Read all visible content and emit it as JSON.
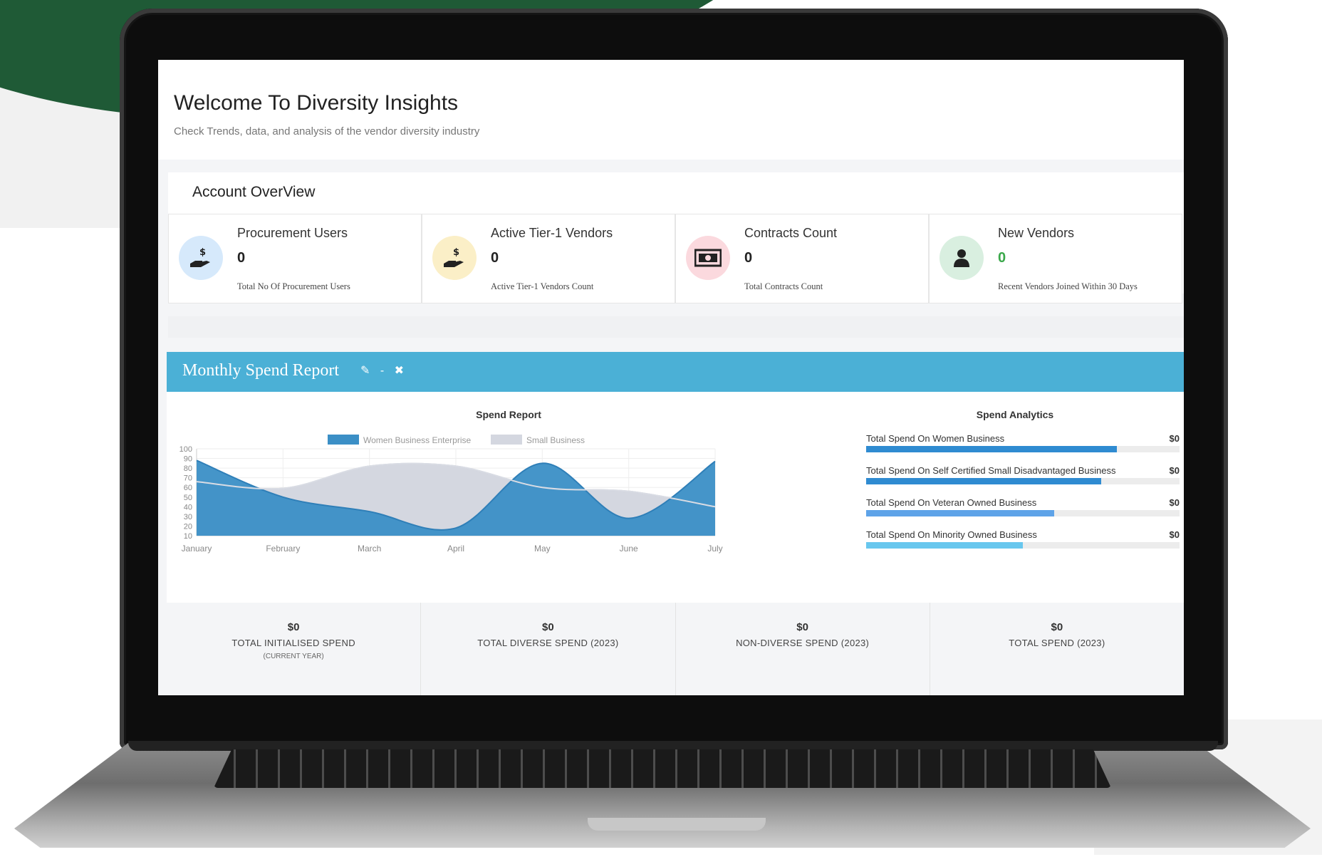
{
  "header": {
    "title": "Welcome To Diversity Insights",
    "subtitle": "Check Trends, data, and analysis of the vendor diversity industry"
  },
  "overview": {
    "title": "Account OverView",
    "cards": [
      {
        "title": "Procurement Users",
        "value": "0",
        "note": "Total No Of Procurement Users",
        "icon": "hand-money-icon",
        "icon_bg": "#d6e9fb",
        "value_color": "#222222"
      },
      {
        "title": "Active Tier-1 Vendors",
        "value": "0",
        "note": "Active Tier-1 Vendors Count",
        "icon": "hand-money-icon",
        "icon_bg": "#fbefc7",
        "value_color": "#222222"
      },
      {
        "title": "Contracts Count",
        "value": "0",
        "note": "Total Contracts Count",
        "icon": "banknote-icon",
        "icon_bg": "#fbd9de",
        "value_color": "#222222"
      },
      {
        "title": "New Vendors",
        "value": "0",
        "note": "Recent Vendors Joined Within 30 Days",
        "icon": "user-icon",
        "icon_bg": "#d9efe0",
        "value_color": "#3aa84a"
      }
    ]
  },
  "panel": {
    "title": "Monthly Spend Report",
    "tools": {
      "edit": "✎",
      "collapse": "-",
      "close": "✖"
    }
  },
  "chart_data": {
    "type": "area",
    "title": "Spend Report",
    "x": [
      "January",
      "February",
      "March",
      "April",
      "May",
      "June",
      "July"
    ],
    "ylim": [
      10,
      100
    ],
    "yticks": [
      10,
      20,
      30,
      40,
      50,
      60,
      70,
      80,
      90,
      100
    ],
    "legend_position": "top-center",
    "grid": true,
    "series": [
      {
        "name": "Women Business Enterprise",
        "values": [
          88,
          50,
          35,
          18,
          85,
          28,
          87
        ],
        "color": "#3b8fc6"
      },
      {
        "name": "Small Business",
        "values": [
          66,
          59,
          82,
          82,
          60,
          56,
          40
        ],
        "color": "#d4d7e0"
      }
    ]
  },
  "analytics": {
    "title": "Spend Analytics",
    "rows": [
      {
        "label": "Total Spend On Women Business",
        "value": "$0",
        "fill": 0.8,
        "color": "#2f8bd1"
      },
      {
        "label": "Total Spend On Self Certified Small Disadvantaged Business",
        "value": "$0",
        "fill": 0.75,
        "color": "#2f8bd1"
      },
      {
        "label": "Total Spend On Veteran Owned Business",
        "value": "$0",
        "fill": 0.6,
        "color": "#5ea3e8"
      },
      {
        "label": "Total Spend On Minority Owned Business",
        "value": "$0",
        "fill": 0.5,
        "color": "#68c7ee"
      }
    ]
  },
  "totals": [
    {
      "value": "$0",
      "label": "TOTAL INITIALISED SPEND",
      "sub": "(CURRENT YEAR)"
    },
    {
      "value": "$0",
      "label": "TOTAL DIVERSE SPEND (2023)",
      "sub": ""
    },
    {
      "value": "$0",
      "label": "NON-DIVERSE SPEND (2023)",
      "sub": ""
    },
    {
      "value": "$0",
      "label": "TOTAL SPEND (2023)",
      "sub": ""
    }
  ]
}
